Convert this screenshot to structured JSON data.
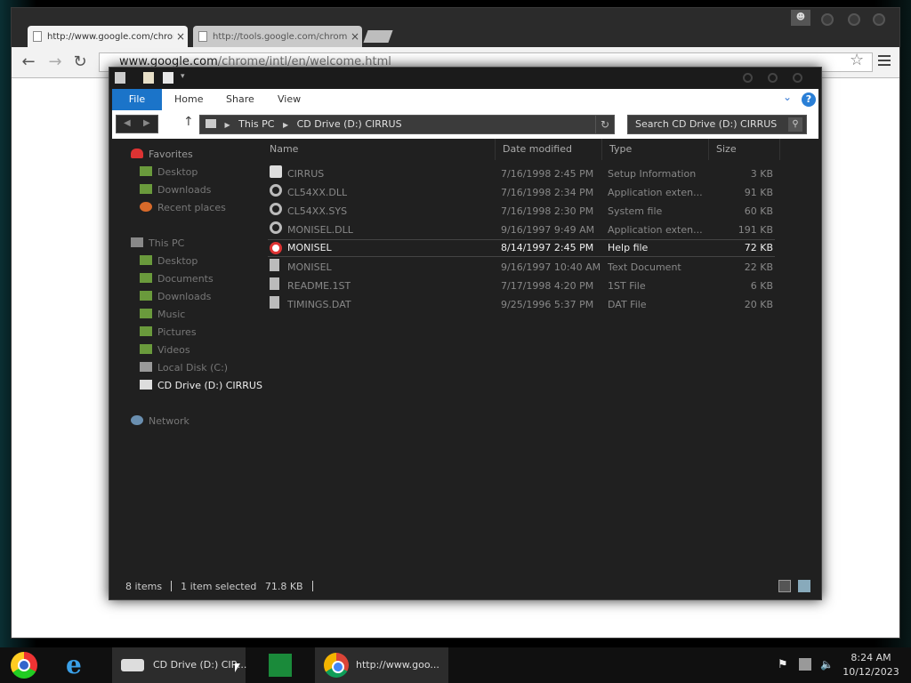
{
  "chrome": {
    "tabs": [
      {
        "title": "http://www.google.com/chrome",
        "active": true
      },
      {
        "title": "http://tools.google.com/chrome",
        "active": false
      }
    ],
    "url_domain": "www.google.com",
    "url_path": "/chrome/intl/en/welcome.html"
  },
  "explorer": {
    "ribbon_tabs": [
      "File",
      "Home",
      "Share",
      "View"
    ],
    "breadcrumb": [
      "This PC",
      "CD Drive (D:) CIRRUS"
    ],
    "search_placeholder": "Search CD Drive (D:) CIRRUS",
    "nav": {
      "favorites": "Favorites",
      "favorites_items": [
        "Desktop",
        "Downloads",
        "Recent places"
      ],
      "this_pc": "This PC",
      "this_pc_items": [
        "Desktop",
        "Documents",
        "Downloads",
        "Music",
        "Pictures",
        "Videos",
        "Local Disk (C:)",
        "CD Drive (D:) CIRRUS"
      ],
      "network": "Network"
    },
    "columns": [
      "Name",
      "Date modified",
      "Type",
      "Size"
    ],
    "files": [
      {
        "name": "CIRRUS",
        "date": "7/16/1998 2:45 PM",
        "type": "Setup Information",
        "size": "3 KB",
        "icon": "setup-info-icon"
      },
      {
        "name": "CL54XX.DLL",
        "date": "7/16/1998 2:34 PM",
        "type": "Application exten...",
        "size": "91 KB",
        "icon": "gear-icon"
      },
      {
        "name": "CL54XX.SYS",
        "date": "7/16/1998 2:30 PM",
        "type": "System file",
        "size": "60 KB",
        "icon": "gear-icon"
      },
      {
        "name": "MONISEL.DLL",
        "date": "9/16/1997 9:49 AM",
        "type": "Application exten...",
        "size": "191 KB",
        "icon": "gear-icon"
      },
      {
        "name": "MONISEL",
        "date": "8/14/1997 2:45 PM",
        "type": "Help file",
        "size": "72 KB",
        "icon": "lifebuoy-icon",
        "selected": true
      },
      {
        "name": "MONISEL",
        "date": "9/16/1997 10:40 AM",
        "type": "Text Document",
        "size": "22 KB",
        "icon": "text-doc-icon"
      },
      {
        "name": "README.1ST",
        "date": "7/17/1998 4:20 PM",
        "type": "1ST File",
        "size": "6 KB",
        "icon": "blank-file-icon"
      },
      {
        "name": "TIMINGS.DAT",
        "date": "9/25/1996 5:37 PM",
        "type": "DAT File",
        "size": "20 KB",
        "icon": "blank-file-icon"
      }
    ],
    "status_items": "8 items",
    "status_selected": "1 item selected",
    "status_size": "71.8 KB"
  },
  "taskbar": {
    "explorer_label": "CD Drive (D:) CIR...",
    "chrome_label": "http://www.goo...",
    "time": "8:24 AM",
    "date": "10/12/2023"
  },
  "colors": {
    "accent": "#1b74c9",
    "help": "#2a7fd6"
  }
}
